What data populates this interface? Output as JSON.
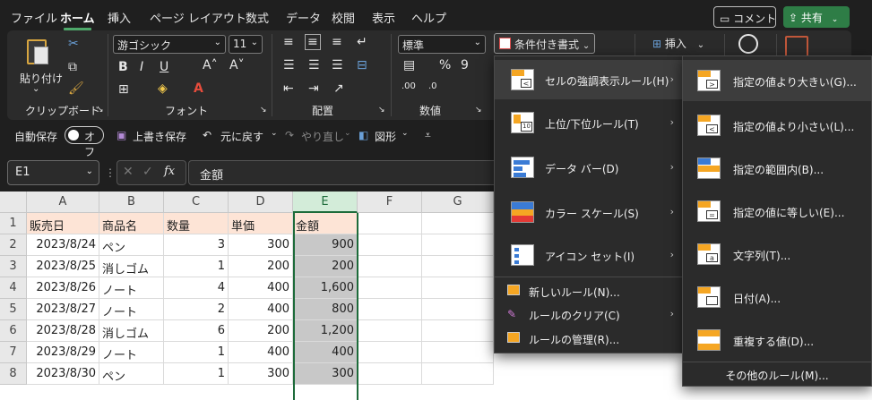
{
  "tabs": [
    "ファイル",
    "ホーム",
    "挿入",
    "ページ レイアウト",
    "数式",
    "データ",
    "校閲",
    "表示",
    "ヘルプ"
  ],
  "buttons": {
    "comment": "コメント",
    "share": "共有"
  },
  "ribbon": {
    "paste": "貼り付け",
    "font_name": "游ゴシック",
    "font_size": "11",
    "number_format": "標準",
    "conditional_format": "条件付き書式",
    "insert": "挿入",
    "groups": {
      "clipboard": "クリップボード",
      "font": "フォント",
      "alignment": "配置",
      "number": "数値"
    }
  },
  "qat": {
    "autosave": "自動保存",
    "toggle": "オフ",
    "save": "上書き保存",
    "undo": "元に戻す",
    "redo": "やり直し",
    "shapes": "図形"
  },
  "formula_bar": {
    "name_box": "E1",
    "fx": "fx",
    "content": "金額"
  },
  "columns": [
    "A",
    "B",
    "C",
    "D",
    "E",
    "F",
    "G"
  ],
  "rows": [
    "1",
    "2",
    "3",
    "4",
    "5",
    "6",
    "7",
    "8"
  ],
  "table": {
    "headers": [
      "販売日",
      "商品名",
      "数量",
      "単価",
      "金額"
    ],
    "data": [
      [
        "2023/8/24",
        "ペン",
        "3",
        "300",
        "900"
      ],
      [
        "2023/8/25",
        "消しゴム",
        "1",
        "200",
        "200"
      ],
      [
        "2023/8/26",
        "ノート",
        "4",
        "400",
        "1,600"
      ],
      [
        "2023/8/27",
        "ノート",
        "2",
        "400",
        "800"
      ],
      [
        "2023/8/28",
        "消しゴム",
        "6",
        "200",
        "1,200"
      ],
      [
        "2023/8/29",
        "ノート",
        "1",
        "400",
        "400"
      ],
      [
        "2023/8/30",
        "ペン",
        "1",
        "300",
        "300"
      ]
    ]
  },
  "menu_main": [
    "セルの強調表示ルール(H)",
    "上位/下位ルール(T)",
    "データ バー(D)",
    "カラー スケール(S)",
    "アイコン セット(I)",
    "新しいルール(N)...",
    "ルールのクリア(C)",
    "ルールの管理(R)..."
  ],
  "menu_sub": [
    "指定の値より大きい(G)...",
    "指定の値より小さい(L)...",
    "指定の範囲内(B)...",
    "指定の値に等しい(E)...",
    "文字列(T)...",
    "日付(A)...",
    "重複する値(D)...",
    "その他のルール(M)..."
  ],
  "colors": {
    "accent": "#2e7d46",
    "header_fill": "#fde4d6",
    "selected_col": "#c8c8c8"
  }
}
